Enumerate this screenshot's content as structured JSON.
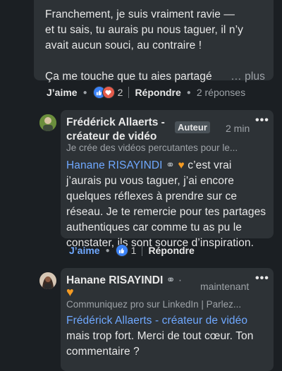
{
  "top_comment": {
    "lines": [
      "Franchement, je suis vraiment ravie —",
      "et tu sais, tu aurais pu nous taguer, il n’y",
      "avait aucun souci, au contraire !",
      "Ça me touche que tu aies partagé"
    ],
    "more_label": "… plus",
    "like_label": "J’aime",
    "reaction_count": "2",
    "reply_label": "Répondre",
    "replies_label": "2 réponses"
  },
  "reply1": {
    "author_line1": "Frédérick Allaerts -",
    "author_line2": "créateur de vidéo",
    "badge": "Auteur",
    "time": "2 min",
    "headline": "Je crée des vidéos percutantes pour le...",
    "mention": "Hanane RISAYINDI",
    "text_first": " c’est vrai",
    "lines": [
      "j’aurais pu vous taguer, j’ai encore",
      "quelques réflexes à prendre sur ce",
      "réseau. Je te remercie pour tes partages",
      "authentiques car comme tu as pu le",
      "constater, ils sont source d’inspiration."
    ],
    "like_label": "J’aime",
    "reaction_count": "1",
    "reply_label": "Répondre"
  },
  "reply2": {
    "author": "Hanane RISAYINDI",
    "time": "maintenant",
    "headline": "Communiquez pro sur LinkedIn | Parlez...",
    "mention": "Frédérick Allaerts - créateur de vidéo",
    "lines": [
      "mais trop fort. Merci de tout cœur. Ton",
      "commentaire ?"
    ]
  },
  "colors": {
    "background": "#1b1f23",
    "bubble": "#2d3236",
    "link": "#6fa8ff",
    "like_active": "#6fa8ff"
  },
  "icons": {
    "like_reaction": "thumbs-up-icon",
    "love_reaction": "heart-icon",
    "more": "ellipsis-icon",
    "heart_emoji": "orange-heart-icon",
    "link_emoji": "link-icon"
  }
}
